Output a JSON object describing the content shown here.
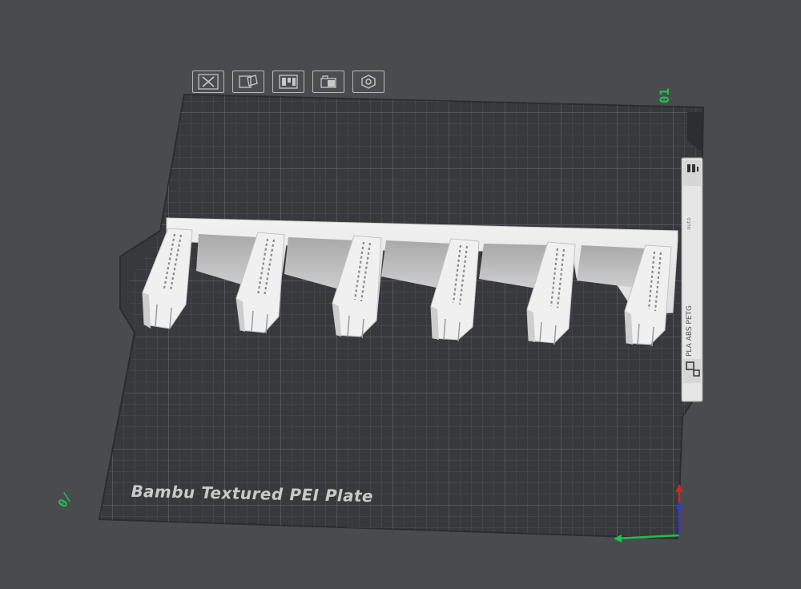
{
  "plate": {
    "name": "Bambu Textured PEI Plate",
    "number": "01",
    "corner_marker": "0/"
  },
  "toolbar": {
    "buttons": [
      {
        "name": "Delete",
        "icon": "delete-icon"
      },
      {
        "name": "Arrange",
        "icon": "arrange-icon"
      },
      {
        "name": "Auto orient",
        "icon": "orient-icon"
      },
      {
        "name": "Lock",
        "icon": "lock-icon"
      },
      {
        "name": "Settings",
        "icon": "settings-icon"
      }
    ]
  },
  "side_panel": {
    "filament_label": "PLA ABS PETG",
    "small_label": "auto"
  },
  "colors": {
    "background": "#4a4b4e",
    "plate": "#3a3b3e",
    "grid": "#55565a",
    "model": "#e8e8e8",
    "accent_green": "#1fc14a",
    "axis_red": "#e02020",
    "axis_blue": "#2040e0"
  }
}
